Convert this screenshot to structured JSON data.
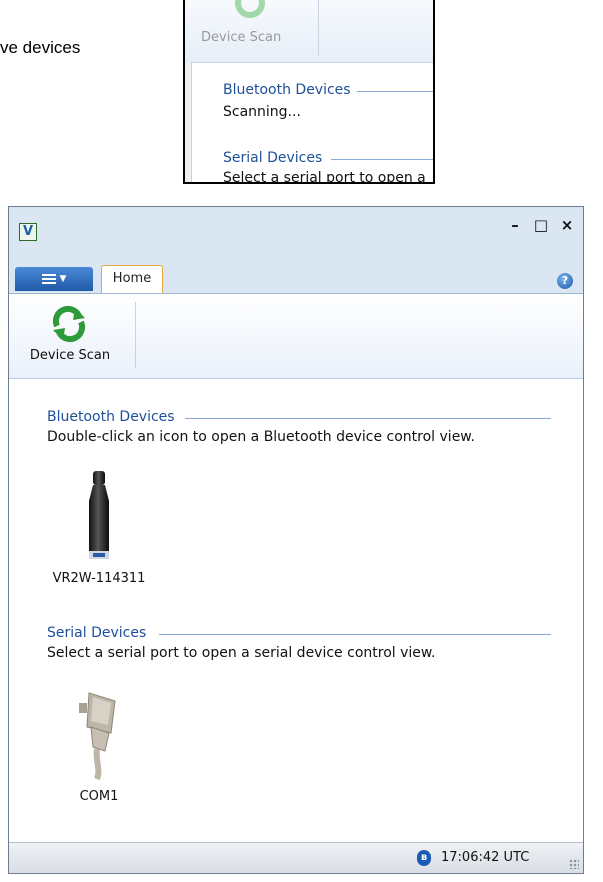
{
  "caption": {
    "text": "ve devices"
  },
  "inset": {
    "device_scan_label": "Device Scan",
    "bluetooth_heading": "Bluetooth Devices",
    "bluetooth_status": "Scanning...",
    "serial_heading": "Serial Devices",
    "serial_text": "Select a serial port to open a"
  },
  "window": {
    "logo_letter": "V",
    "controls": {
      "minimize": "–",
      "maximize": "□",
      "close": "×"
    },
    "tabs": [
      {
        "label": "Home",
        "active": true
      }
    ],
    "help_symbol": "?",
    "ribbon": {
      "device_scan_label": "Device Scan"
    },
    "bluetooth": {
      "heading": "Bluetooth Devices",
      "description": "Double-click an icon to open a Bluetooth device control view.",
      "devices": [
        {
          "name": "VR2W-114311",
          "icon": "receiver-icon"
        }
      ]
    },
    "serial": {
      "heading": "Serial Devices",
      "description": "Select a serial port to open a serial device control view.",
      "devices": [
        {
          "name": "COM1",
          "icon": "serial-connector-icon"
        }
      ]
    },
    "status": {
      "bluetooth_symbol": "ʙ",
      "time": "17:06:42 UTC"
    }
  },
  "colors": {
    "accent": "#1e4f99",
    "menu": "#2f6fc2",
    "tab_border": "#e6a940",
    "scan_icon": "#2e9a3a"
  }
}
